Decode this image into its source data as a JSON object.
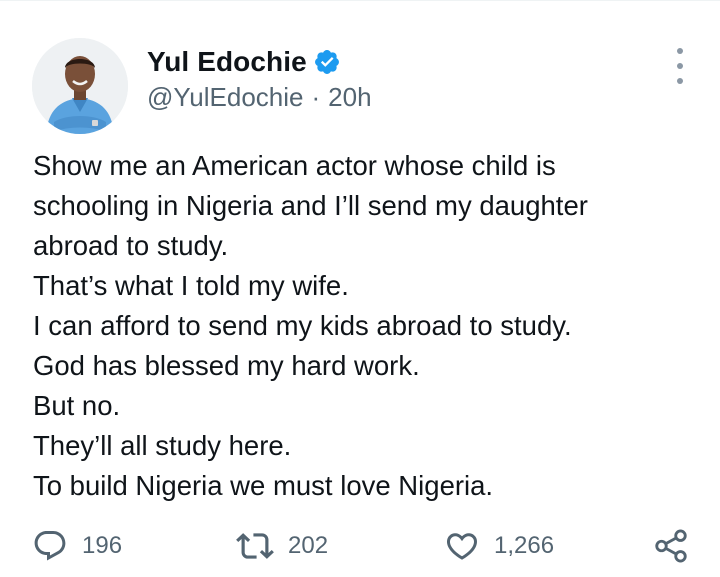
{
  "author": {
    "display_name": "Yul Edochie",
    "handle": "@YulEdochie",
    "separator": "·",
    "time_ago": "20h",
    "verified": true
  },
  "tweet": {
    "lines": [
      "Show me an American actor whose child is",
      "schooling in Nigeria and I’ll send my daughter",
      "abroad to study.",
      "That’s what I told my wife.",
      "I can afford to send my kids abroad to study.",
      "God has blessed my hard work.",
      "But no.",
      "They’ll all study here.",
      "To build Nigeria we must love Nigeria."
    ]
  },
  "actions": {
    "replies": "196",
    "retweets": "202",
    "likes": "1,266"
  },
  "icons": {
    "reply": "speech-bubble-icon",
    "retweet": "retweet-arrows-icon",
    "like": "heart-icon",
    "share": "share-icon",
    "more": "more-options-icon",
    "verified": "verified-badge-icon"
  },
  "colors": {
    "text_primary": "#0f1419",
    "text_secondary": "#536471",
    "verified_blue": "#1d9bf0"
  }
}
